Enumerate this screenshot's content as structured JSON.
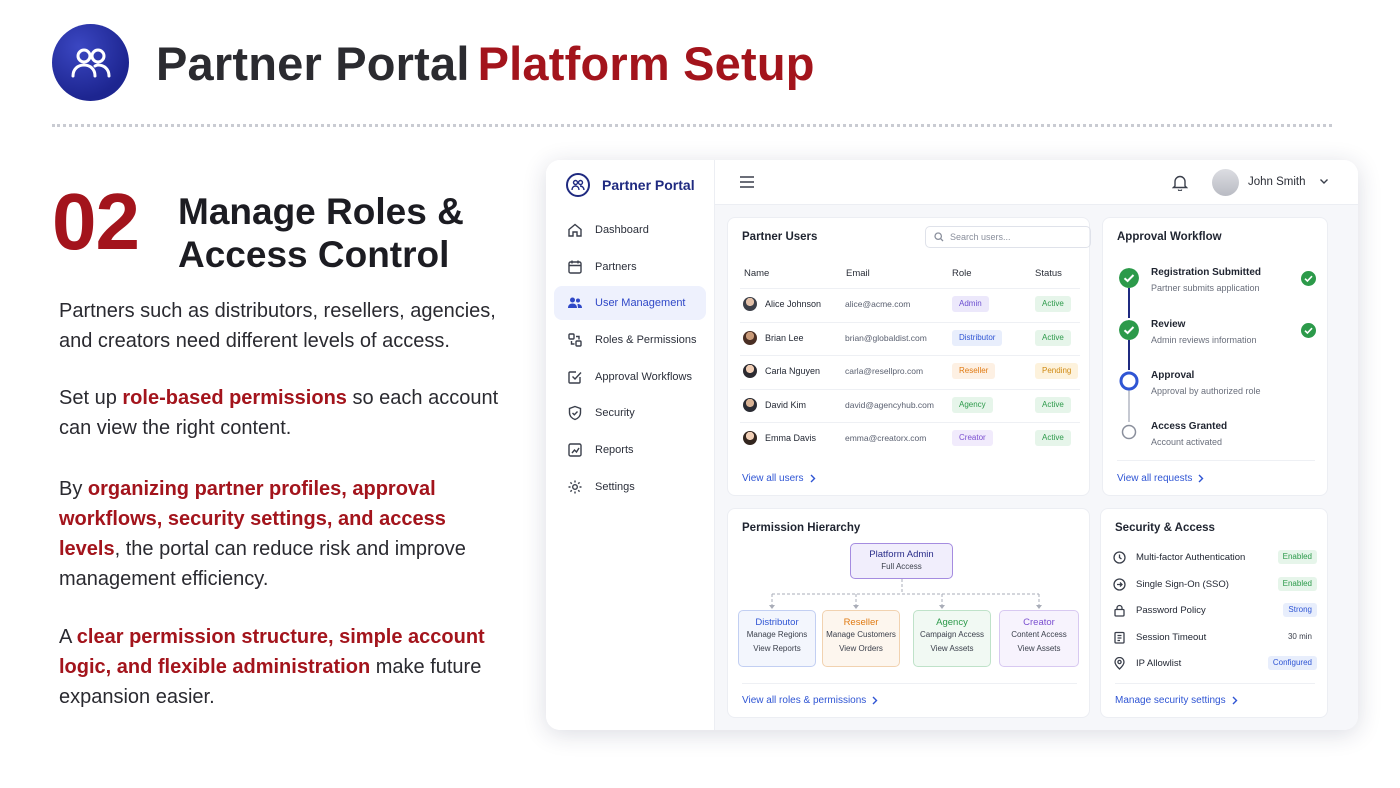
{
  "header": {
    "title_main": "Partner Portal",
    "title_accent": "Platform Setup",
    "logo_icon": "users-icon"
  },
  "section": {
    "number": "02",
    "title_line1": "Manage Roles &",
    "title_line2": "Access Control"
  },
  "paragraphs": {
    "p1": "Partners such as distributors, resellers, agencies, and creators need different levels of access.",
    "p2_a": "Set up ",
    "p2_hl": "role-based permissions",
    "p2_b": " so each account can view the right content.",
    "p3_a": "By ",
    "p3_hl": "organizing partner profiles, approval workflows, security settings, and access levels",
    "p3_b": ", the portal can reduce risk and improve management efficiency.",
    "p4_a": "A ",
    "p4_hl": "clear permission structure, simple account logic, and flexible administration",
    "p4_b": " make future expansion easier."
  },
  "app": {
    "brand": "Partner Portal",
    "user": "John Smith",
    "nav": [
      {
        "label": "Dashboard",
        "icon": "home-icon"
      },
      {
        "label": "Partners",
        "icon": "calendar-icon"
      },
      {
        "label": "User Management",
        "icon": "users-icon",
        "active": true
      },
      {
        "label": "Roles & Permissions",
        "icon": "roles-icon"
      },
      {
        "label": "Approval Workflows",
        "icon": "check-square-icon"
      },
      {
        "label": "Security",
        "icon": "shield-icon"
      },
      {
        "label": "Reports",
        "icon": "chart-icon"
      },
      {
        "label": "Settings",
        "icon": "gear-icon"
      }
    ],
    "users_card": {
      "title": "Partner Users",
      "search_placeholder": "Search users...",
      "columns": [
        "Name",
        "Email",
        "Role",
        "Status"
      ],
      "rows": [
        {
          "name": "Alice Johnson",
          "email": "alice@acme.com",
          "role": "Admin",
          "status": "Active"
        },
        {
          "name": "Brian Lee",
          "email": "brian@globaldist.com",
          "role": "Distributor",
          "status": "Active"
        },
        {
          "name": "Carla Nguyen",
          "email": "carla@resellpro.com",
          "role": "Reseller",
          "status": "Pending"
        },
        {
          "name": "David Kim",
          "email": "david@agencyhub.com",
          "role": "Agency",
          "status": "Active"
        },
        {
          "name": "Emma Davis",
          "email": "emma@creatorx.com",
          "role": "Creator",
          "status": "Active"
        }
      ],
      "link": "View all users"
    },
    "approval_card": {
      "title": "Approval Workflow",
      "steps": [
        {
          "title": "Registration Submitted",
          "sub": "Partner submits application",
          "state": "done"
        },
        {
          "title": "Review",
          "sub": "Admin reviews information",
          "state": "done"
        },
        {
          "title": "Approval",
          "sub": "Approval by authorized role",
          "state": "current"
        },
        {
          "title": "Access Granted",
          "sub": "Account activated",
          "state": "pending"
        }
      ],
      "link": "View all requests"
    },
    "hierarchy_card": {
      "title": "Permission Hierarchy",
      "root": {
        "title": "Platform Admin",
        "sub": "Full Access"
      },
      "children": [
        {
          "title": "Distributor",
          "lines": [
            "Manage Regions",
            "View Reports"
          ],
          "color": "#2f55d4"
        },
        {
          "title": "Reseller",
          "lines": [
            "Manage Customers",
            "View Orders"
          ],
          "color": "#e07a12"
        },
        {
          "title": "Agency",
          "lines": [
            "Campaign Access",
            "View Assets"
          ],
          "color": "#2c9a4a"
        },
        {
          "title": "Creator",
          "lines": [
            "Content Access",
            "View Assets"
          ],
          "color": "#7b4fd0"
        }
      ],
      "link": "View all roles & permissions"
    },
    "security_card": {
      "title": "Security & Access",
      "rows": [
        {
          "label": "Multi-factor Authentication",
          "value": "Enabled",
          "icon": "clock-icon"
        },
        {
          "label": "Single Sign-On (SSO)",
          "value": "Enabled",
          "icon": "sso-icon"
        },
        {
          "label": "Password Policy",
          "value": "Strong",
          "icon": "lock-icon"
        },
        {
          "label": "Session Timeout",
          "value": "30 min",
          "icon": "timer-icon"
        },
        {
          "label": "IP Allowlist",
          "value": "Configured",
          "icon": "location-icon"
        }
      ],
      "link": "Manage security settings"
    }
  },
  "colors": {
    "accent_red": "#a3141c",
    "brand_navy": "#1f2a80",
    "link_blue": "#2f55d4",
    "success_green": "#2c9a4a"
  }
}
